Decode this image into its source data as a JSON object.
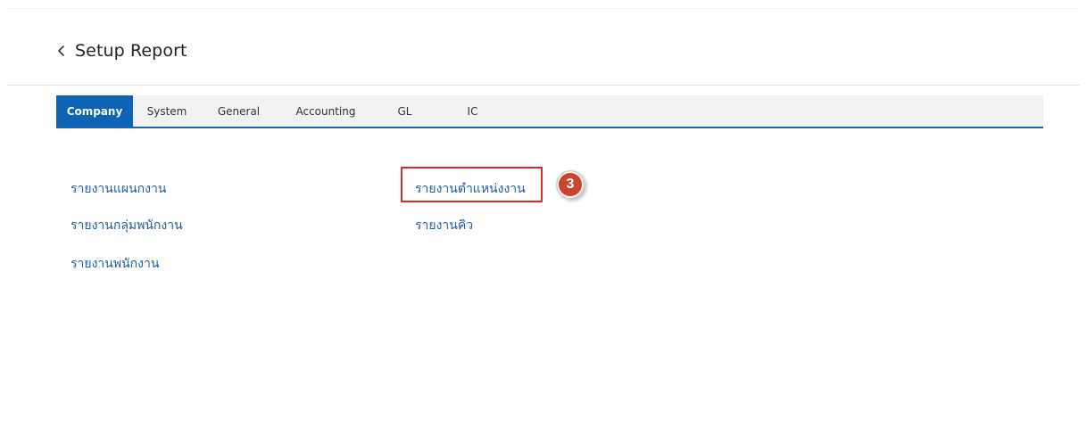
{
  "header": {
    "back_icon": "chevron-left-icon",
    "title": "Setup Report"
  },
  "tabs": [
    {
      "label": "Company",
      "active": true
    },
    {
      "label": "System",
      "active": false
    },
    {
      "label": "General",
      "active": false
    },
    {
      "label": "Accounting",
      "active": false
    },
    {
      "label": "GL",
      "active": false
    },
    {
      "label": "IC",
      "active": false
    }
  ],
  "reports": {
    "left_column": [
      "รายงานแผนกงาน",
      "รายงานกลุ่มพนักงาน",
      "รายงานพนักงาน"
    ],
    "right_column": [
      "รายงานตำแหน่งงาน",
      "รายงานคิว"
    ]
  },
  "annotation": {
    "step_number": "3",
    "highlight_color": "#e3262b",
    "badge_color": "#c9452d"
  },
  "colors": {
    "accent": "#0e64b4",
    "link": "#1f5fa6",
    "tabbar_bg": "#f2f2f2"
  }
}
